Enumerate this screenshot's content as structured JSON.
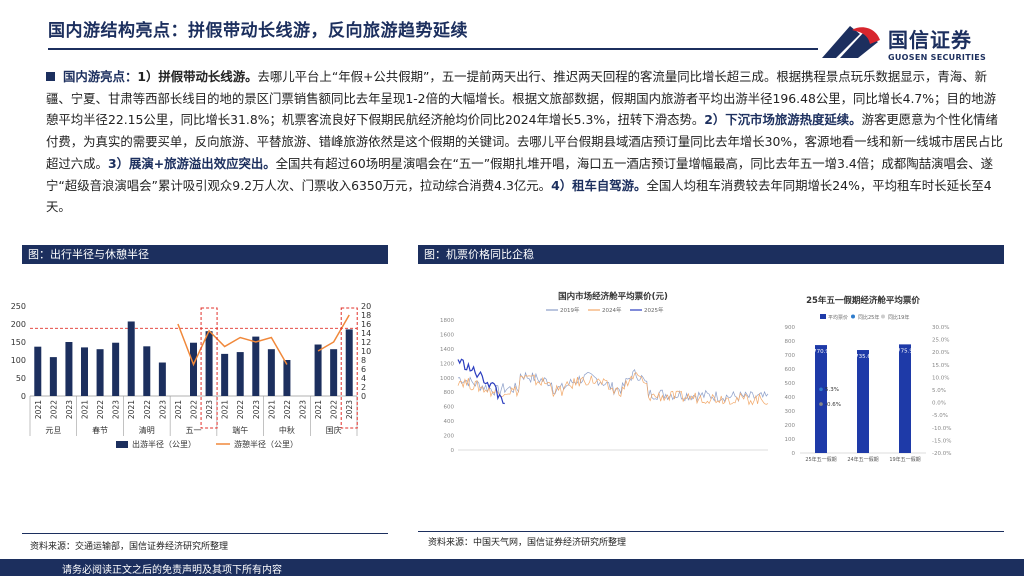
{
  "header": {
    "title": "国内游结构亮点：拼假带动长线游，反向旅游趋势延续",
    "logo_cn": "国信证券",
    "logo_en": "GUOSEN SECURITIES"
  },
  "body": {
    "p1_label": "国内游亮点：",
    "p1_h1": "1）拼假带动长线游。",
    "p1_t1": "去哪儿平台上“年假+公共假期”，五一提前两天出行、推迟两天回程的客流量同比增长超三成。根据携程景点玩乐数据显示，青海、新疆、宁夏、甘肃等西部长线目的地的景区门票销售额同比去年呈现1-2倍的大幅增长。根据文旅部数据，假期国内旅游者平均出游半径196.48公里，同比增长4.7%；目的地游憩平均半径22.15公里，同比增长31.8%；机票客流良好下假期民航经济舱均价同比2024年增长5.3%，扭转下滑态势。",
    "p1_h2": "2）下沉市场旅游热度延续。",
    "p1_t2": "游客更愿意为个性化情绪付费，为真实的需要买单，反向旅游、平替旅游、错峰旅游依然是这个假期的关键词。去哪儿平台假期县域酒店预订量同比去年增长30%，客源地看一线和新一线城市居民占比超过六成。",
    "p1_h3": "3）展演+旅游溢出效应突出。",
    "p1_t3": "全国共有超过60场明星演唱会在“五一”假期扎堆开唱，海口五一酒店预订量增幅最高，同比去年五一增3.4倍；成都陶喆演唱会、遂宁“超级音浪演唱会”累计吸引观众9.2万人次、门票收入6350万元，拉动综合消费4.3亿元。",
    "p1_h4": "4）租车自驾游。",
    "p1_t4": "全国人均租车消费较去年同期增长24%，平均租车时长延长至4天。"
  },
  "panels": {
    "left_title": "图：出行半径与休憩半径",
    "right_title": "图：机票价格同比企稳",
    "left_source": "资料来源：交通运输部，国信证券经济研究所整理",
    "right_source": "资料来源：中国天气网，国信证券经济研究所整理"
  },
  "footer": {
    "disclaimer": "请务必阅读正文之后的免责声明及其项下所有内容"
  },
  "colors": {
    "navy": "#1c2f5e",
    "orange": "#f0883a",
    "highlight_red": "#e0302a"
  },
  "chart_data": [
    {
      "type": "bar",
      "title": "",
      "groups": [
        "元旦",
        "春节",
        "清明",
        "五一",
        "端午",
        "中秋",
        "国庆"
      ],
      "categories": [
        "2021",
        "2022",
        "2023",
        "2021",
        "2022",
        "2023",
        "2021",
        "2022",
        "2023",
        "2021",
        "2022",
        "2023",
        "2021",
        "2022",
        "2023",
        "2021",
        "2022",
        "2023",
        "2021",
        "2022",
        "2023"
      ],
      "series": [
        {
          "name": "出游半径（公里）",
          "axis": "left",
          "type": "bar",
          "values": [
            137,
            108,
            150,
            135,
            130,
            148,
            207,
            138,
            93,
            null,
            148,
            180,
            117,
            122,
            165,
            130,
            100,
            null,
            143,
            130,
            185
          ]
        },
        {
          "name": "游憩半径（公里）",
          "axis": "right",
          "type": "line",
          "values": [
            null,
            null,
            null,
            null,
            null,
            null,
            null,
            null,
            null,
            16,
            7,
            14.5,
            11,
            13,
            12,
            13,
            7,
            null,
            10,
            12,
            18
          ]
        }
      ],
      "ylim_left": [
        0,
        250
      ],
      "yticks_left": [
        0,
        50,
        100,
        150,
        200,
        250
      ],
      "ylim_right": [
        0,
        20
      ],
      "yticks_right": [
        0,
        2,
        4,
        6,
        8,
        10,
        12,
        14,
        16,
        18,
        20
      ],
      "highlight": [
        "五一 2023",
        "国庆 2023"
      ],
      "legend_position": "bottom"
    },
    {
      "type": "line",
      "title": "国内市场经济舱平均票价(元)",
      "series": [
        {
          "name": "2019年",
          "color": "#8c9ec8",
          "pattern": "noisy-seasonal",
          "level": 1050
        },
        {
          "name": "2024年",
          "color": "#f2a869",
          "pattern": "noisy-seasonal",
          "level": 1000
        },
        {
          "name": "2025年",
          "color": "#2b3dbf",
          "pattern": "short",
          "level": 1200
        }
      ],
      "ylim": [
        0,
        1800
      ],
      "yticks": [
        0,
        200,
        400,
        600,
        800,
        1000,
        1200,
        1400,
        1600,
        1800
      ]
    },
    {
      "type": "bar",
      "title": "25年五一假期经济舱平均票价",
      "categories": [
        "25年五一假期",
        "24年五一假期",
        "19年五一假期"
      ],
      "series": [
        {
          "name": "平均票价",
          "axis": "left",
          "values": [
            770.9,
            735.6,
            775.9
          ]
        },
        {
          "name": "同比25年",
          "axis": "right",
          "values": [
            5.3,
            null,
            null
          ]
        },
        {
          "name": "同比19年",
          "axis": "right",
          "values": [
            -0.6,
            null,
            null
          ]
        }
      ],
      "data_labels": [
        "770.9",
        "735.6",
        "775.9",
        "5.3%",
        "-0.6%"
      ],
      "ylim_left": [
        0,
        900
      ],
      "yticks_left": [
        "0",
        "100",
        "200",
        "300",
        "400",
        "500",
        "600",
        "700",
        "800",
        "900"
      ],
      "ylim_right": [
        -20,
        30
      ],
      "yticks_right": [
        "-20.0%",
        "-15.0%",
        "-10.0%",
        "-5.0%",
        "0.0%",
        "5.0%",
        "10.0%",
        "15.0%",
        "20.0%",
        "25.0%",
        "30.0%"
      ],
      "legend_position": "top"
    }
  ]
}
